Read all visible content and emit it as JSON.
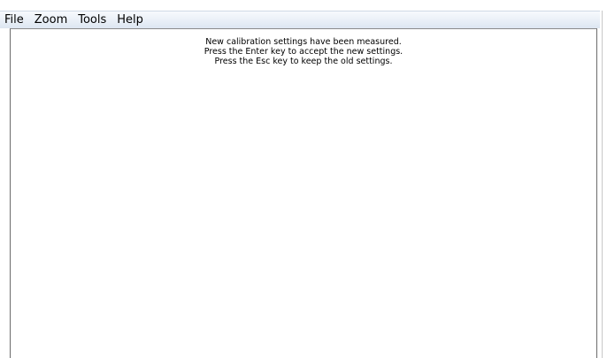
{
  "menubar": {
    "items": [
      {
        "label": "File"
      },
      {
        "label": "Zoom"
      },
      {
        "label": "Tools"
      },
      {
        "label": "Help"
      }
    ]
  },
  "message": {
    "lines": [
      "New calibration settings have been measured.",
      "Press the Enter key to accept the new settings.",
      "Press the Esc key to keep the old settings."
    ]
  }
}
